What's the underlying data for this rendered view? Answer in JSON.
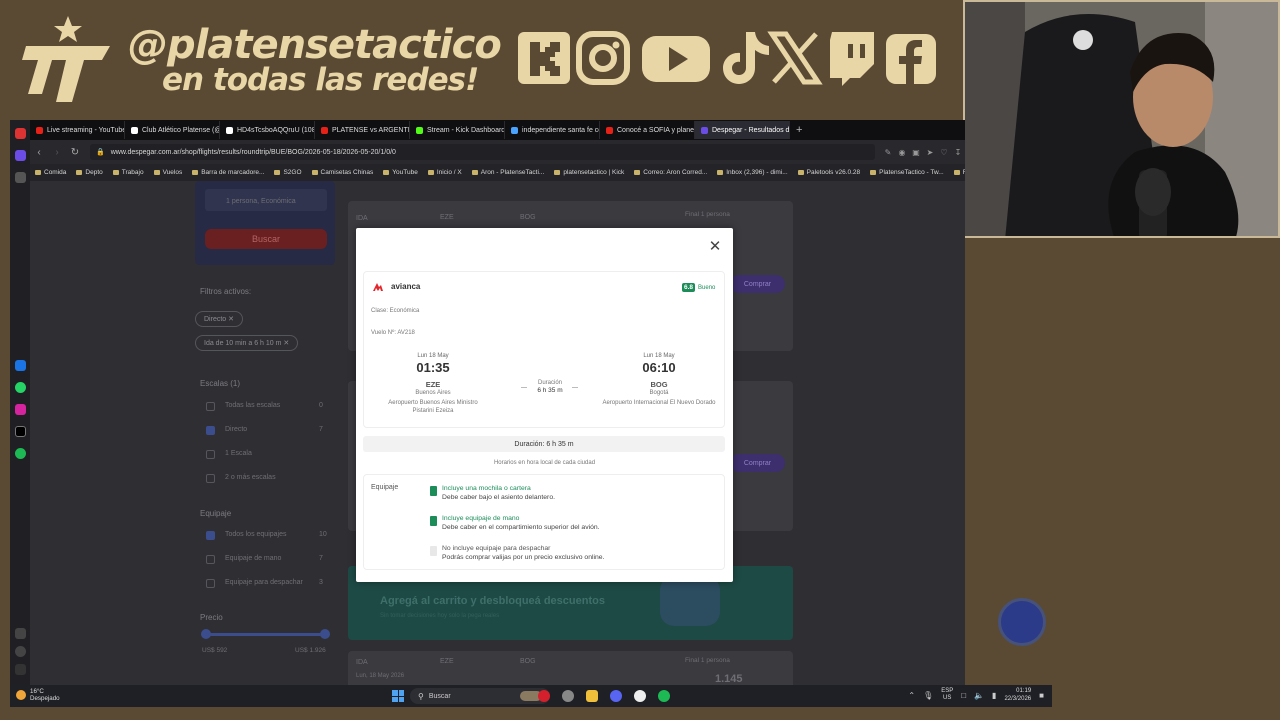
{
  "banner": {
    "handle": "@platensetactico",
    "tagline": "en todas las redes!",
    "logo_text": "PT",
    "social_icons": [
      "kick-icon",
      "instagram-icon",
      "youtube-icon",
      "tiktok-icon",
      "x-icon",
      "twitch-icon",
      "facebook-icon"
    ]
  },
  "browser": {
    "tabs": [
      {
        "label": "Live streaming - YouTube",
        "color": "#e62117"
      },
      {
        "label": "Club Atlético Platense (@",
        "color": "#ffffff"
      },
      {
        "label": "HD4sTcsboAQQruU (1080",
        "color": "#ffffff"
      },
      {
        "label": "PLATENSE vs ARGENTINO",
        "color": "#e62117"
      },
      {
        "label": "Stream - Kick Dashboard",
        "color": "#53fc18"
      },
      {
        "label": "independiente santa fe co",
        "color": "#4aa3ff"
      },
      {
        "label": "Conocé a SOFIA y planeá",
        "color": "#e62117"
      },
      {
        "label": "Despegar - Resultados de",
        "color": "#6b4de6",
        "active": true
      }
    ],
    "url": "www.despegar.com.ar/shop/flights/results/roundtrip/BUE/BOG/2026-05-18/2026-05-20/1/0/0",
    "bookmarks": [
      {
        "label": "Comida"
      },
      {
        "label": "Depto"
      },
      {
        "label": "Trabajo"
      },
      {
        "label": "Vuelos"
      },
      {
        "label": "Barra de marcadore..."
      },
      {
        "label": "S2GO"
      },
      {
        "label": "Camisetas Chinas"
      },
      {
        "label": "YouTube"
      },
      {
        "label": "Inicio / X"
      },
      {
        "label": "Aron - PlatenseTacti..."
      },
      {
        "label": "platensetactico | Kick"
      },
      {
        "label": "Correo: Aron Corred..."
      },
      {
        "label": "Inbox (2,396) - dimi..."
      },
      {
        "label": "Paletools v26.0.28"
      },
      {
        "label": "PlatenseTactico - Tw..."
      },
      {
        "label": "FC"
      }
    ]
  },
  "background_page": {
    "passengers": "1 persona, Económica",
    "search_button": "Buscar",
    "filters_title": "Filtros activos:",
    "chip_direct": "Directo",
    "chip_duration": "Ida de 10 min a 6 h 10 m",
    "stops_title": "Escalas (1)",
    "stops_options": [
      {
        "label": "Todas las escalas",
        "count": "0",
        "checked": false
      },
      {
        "label": "Directo",
        "count": "7",
        "checked": true
      },
      {
        "label": "1 Escala",
        "count": "",
        "checked": false
      },
      {
        "label": "2 o más escalas",
        "count": "",
        "checked": false
      }
    ],
    "baggage_title": "Equipaje",
    "baggage_options": [
      {
        "label": "Todos los equipajes",
        "count": "10",
        "checked": true
      },
      {
        "label": "Equipaje de mano",
        "count": "7",
        "checked": false
      },
      {
        "label": "Equipaje para despachar",
        "count": "3",
        "checked": false
      }
    ],
    "price_title": "Precio",
    "price_min": "US$ 592",
    "price_max": "US$ 1.926",
    "results": {
      "ida": "IDA",
      "eze": "EZE",
      "bog": "BOG",
      "final": "Final 1 persona",
      "price_partial": "1.145",
      "buy": "Comprar",
      "date": "Lun, 18 May 2026"
    },
    "promo_title": "Agregá al carrito y desbloqueá descuentos",
    "promo_sub": "Sin tomar decisiones hoy solo la pega reales"
  },
  "modal": {
    "airline": "avianca",
    "rating_score": "6.8",
    "rating_label": "Bueno",
    "class": "Clase: Económica",
    "flight_no": "Vuelo Nº: AV218",
    "departure": {
      "date": "Lun 18 May",
      "time": "01:35",
      "code": "EZE",
      "city": "Buenos Aires",
      "airport": "Aeropuerto Buenos Aires Ministro Pistarini Ezeiza"
    },
    "arrival": {
      "date": "Lun 18 May",
      "time": "06:10",
      "code": "BOG",
      "city": "Bogotá",
      "airport": "Aeropuerto Internacional El Nuevo Dorado"
    },
    "duration_label": "Duración",
    "duration_value": "6 h 35 m",
    "duration_bar": "Duración: 6 h 35 m",
    "local_note": "Horarios en hora local de cada ciudad",
    "baggage_title": "Equipaje",
    "baggage": [
      {
        "title": "Incluye una mochila o cartera",
        "desc": "Debe caber bajo el asiento delantero.",
        "included": true
      },
      {
        "title": "Incluye equipaje de mano",
        "desc": "Debe caber en el compartimiento superior del avión.",
        "included": true
      },
      {
        "title": "No incluye equipaje para despachar",
        "desc": "Podrás comprar valijas por un precio exclusivo online.",
        "included": false
      }
    ],
    "colors": {
      "included": "#1c8d59",
      "not_included": "#cccccc",
      "rating": "#1c8d59",
      "airline_red": "#e3262b"
    }
  },
  "taskbar": {
    "temp": "16°C",
    "weather": "Despejado",
    "search": "Buscar",
    "lang1": "ESP",
    "lang2": "US",
    "time": "01:19",
    "date": "22/3/2026"
  }
}
